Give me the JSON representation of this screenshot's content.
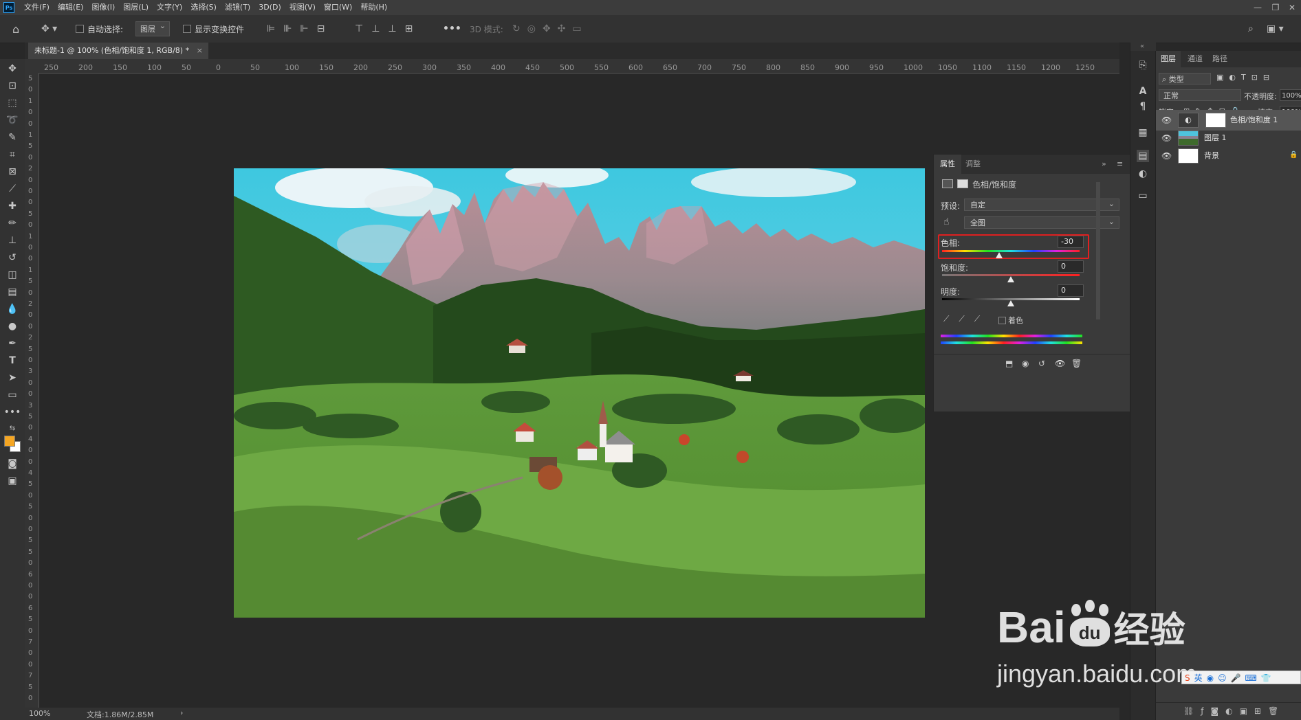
{
  "app": {
    "logo": "Ps",
    "menus": [
      "文件(F)",
      "编辑(E)",
      "图像(I)",
      "图层(L)",
      "文字(Y)",
      "选择(S)",
      "滤镜(T)",
      "3D(D)",
      "视图(V)",
      "窗口(W)",
      "帮助(H)"
    ]
  },
  "options": {
    "auto_select_label": "自动选择:",
    "auto_select_target": "图层",
    "show_transform_label": "显示变换控件",
    "mode_3d_label": "3D 模式:",
    "more": "•••"
  },
  "document": {
    "tab_title": "未标题-1 @ 100% (色相/饱和度 1, RGB/8) *",
    "ruler_h": [
      "250",
      "200",
      "150",
      "100",
      "50",
      "0",
      "50",
      "100",
      "150",
      "200",
      "250",
      "300",
      "350",
      "400",
      "450",
      "500",
      "550",
      "600",
      "650",
      "700",
      "750",
      "800",
      "850",
      "900",
      "950",
      "1000",
      "1050",
      "1100",
      "1150",
      "1200",
      "1250"
    ],
    "ruler_v": [
      "5",
      "0",
      "1",
      "0",
      "0",
      "1",
      "5",
      "0",
      "2",
      "0",
      "0",
      "0",
      "5",
      "0",
      "1",
      "0",
      "0",
      "1",
      "5",
      "0",
      "2",
      "0",
      "0",
      "2",
      "5",
      "0",
      "3",
      "0",
      "0",
      "3",
      "5",
      "0",
      "4",
      "0",
      "0",
      "4",
      "5",
      "0",
      "5",
      "0",
      "0",
      "5",
      "5",
      "0",
      "6",
      "0",
      "0",
      "6",
      "5",
      "0",
      "7",
      "0",
      "0",
      "7",
      "5",
      "0"
    ]
  },
  "status": {
    "zoom": "100%",
    "doc_info": "文档:1.86M/2.85M",
    "arrow": "›"
  },
  "properties": {
    "tabs": [
      "属性",
      "调整"
    ],
    "adjustment_title": "色相/饱和度",
    "preset_label": "预设:",
    "preset_value": "自定",
    "channel_value": "全图",
    "hue_label": "色相:",
    "hue_value": "-30",
    "hue_level": -30,
    "saturation_label": "饱和度:",
    "saturation_value": "0",
    "lightness_label": "明度:",
    "lightness_value": "0",
    "colorize_label": "着色"
  },
  "layers_panel": {
    "tabs": [
      "图层",
      "通道",
      "路径"
    ],
    "filter_label": "类型",
    "blend_mode": "正常",
    "opacity_label": "不透明度:",
    "opacity_value": "100%",
    "lock_label": "锁定:",
    "fill_label": "填充:",
    "fill_value": "100%",
    "layers": [
      {
        "name": "色相/饱和度 1",
        "selected": true
      },
      {
        "name": "图层 1",
        "selected": false
      },
      {
        "name": "背景",
        "selected": false
      }
    ]
  },
  "watermark": {
    "brand": "Bai",
    "brand2": "du",
    "brand_cn": "经验",
    "url": "jingyan.baidu.com"
  },
  "colors": {
    "foreground": "#f5a623",
    "background": "#ffffff",
    "highlight_red": "#e02020"
  }
}
